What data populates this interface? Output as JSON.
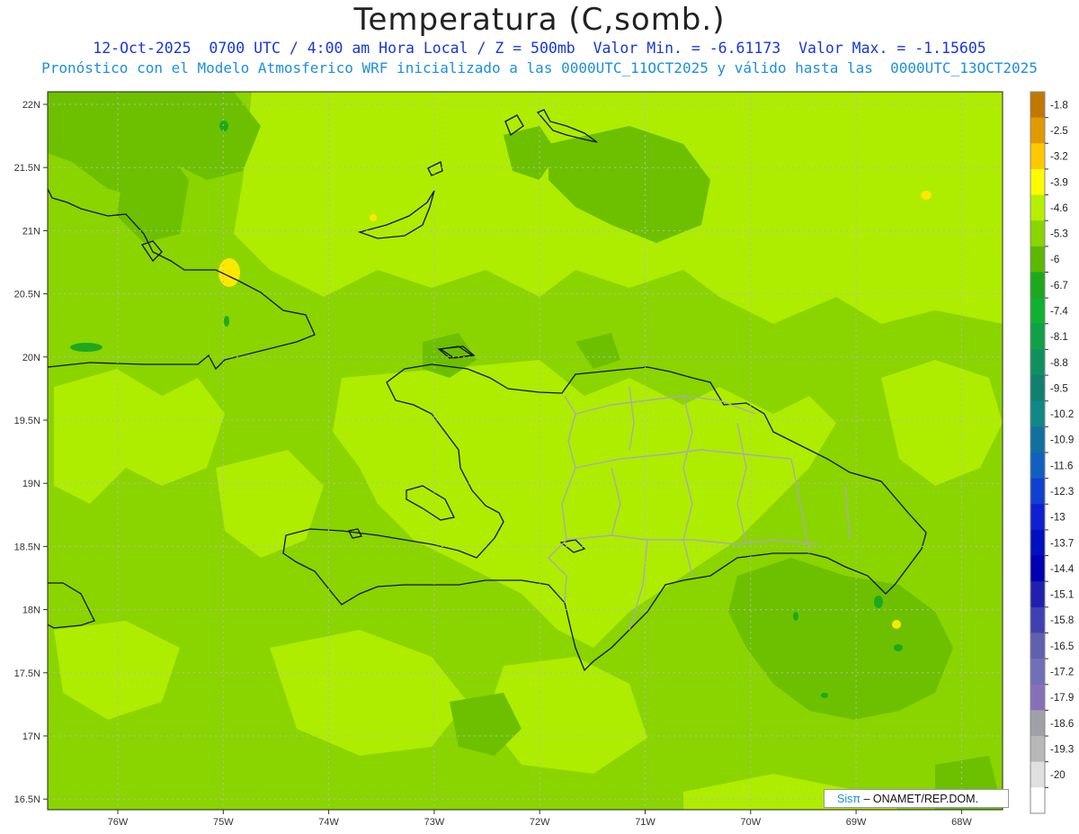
{
  "header": {
    "title": "Temperatura (C,somb.)",
    "subtitle": "12-Oct-2025  0700 UTC / 4:00 am Hora Local / Z = 500mb  Valor Min. = -6.61173  Valor Max. = -1.15605",
    "subtitle2": "Pronóstico con el Modelo Atmosferico WRF inicializado a las 0000UTC_11OCT2025 y válido hasta las  0000UTC_13OCT2025"
  },
  "axes": {
    "lat_labels": [
      "22N",
      "21.5N",
      "21N",
      "20.5N",
      "20N",
      "19.5N",
      "19N",
      "18.5N",
      "18N",
      "17.5N",
      "17N",
      "16.5N"
    ],
    "lon_labels": [
      "76W",
      "75W",
      "74W",
      "73W",
      "72W",
      "71W",
      "70W",
      "69W",
      "68W"
    ]
  },
  "colorbar": {
    "labels": [
      "-1.8",
      "-2.5",
      "-3.2",
      "-3.9",
      "-4.6",
      "-5.3",
      "-6",
      "-6.7",
      "-7.4",
      "-8.1",
      "-8.8",
      "-9.5",
      "-10.2",
      "-10.9",
      "-11.6",
      "-12.3",
      "-13",
      "-13.7",
      "-14.4",
      "-15.1",
      "-15.8",
      "-16.5",
      "-17.2",
      "-17.9",
      "-18.6",
      "-19.3",
      "-20"
    ],
    "colors": [
      "#c07800",
      "#e09a00",
      "#ffc800",
      "#fffa00",
      "#b4f000",
      "#8ad400",
      "#5cb800",
      "#1ea81e",
      "#10b030",
      "#10a048",
      "#109060",
      "#108070",
      "#108888",
      "#1070a0",
      "#1060c0",
      "#1040d0",
      "#1020d0",
      "#0010c0",
      "#0000b0",
      "#2020b0",
      "#4040b0",
      "#6060b0",
      "#7070b8",
      "#8870b8",
      "#a0a0a8",
      "#b8b8b8",
      "#e0e0e0",
      "#ffffff"
    ]
  },
  "field_colors": {
    "base": "#8ad400",
    "light": "#aeec00",
    "dark": "#6cc000",
    "warm": "#ffe800"
  },
  "credit": {
    "logo": "Sisπ",
    "text": " – ONAMET/REP.DOM."
  }
}
